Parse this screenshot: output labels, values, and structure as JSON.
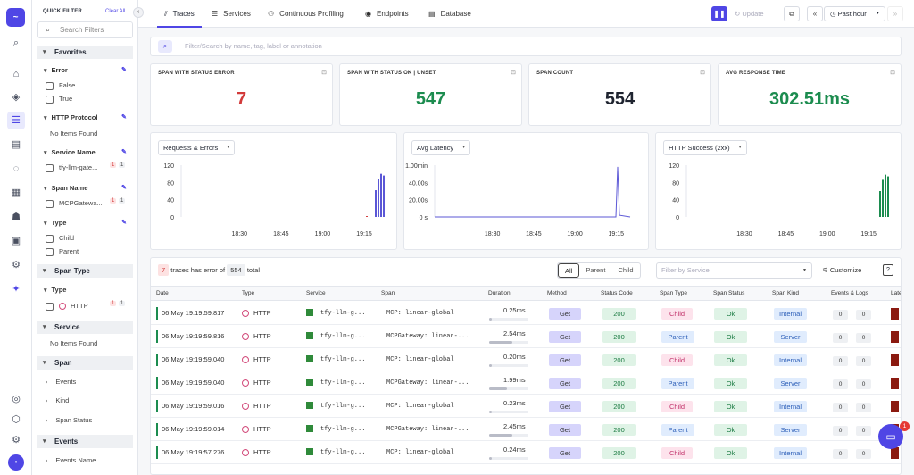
{
  "app": {
    "logo_text": "~"
  },
  "filter_panel": {
    "title": "QUICK FILTER",
    "clear_all": "Clear All",
    "search_placeholder": "Search Filters",
    "sections": {
      "favorites": "Favorites",
      "span_type": "Span Type",
      "service": "Service",
      "span": "Span",
      "events": "Events"
    },
    "error": {
      "label": "Error",
      "options": [
        "False",
        "True"
      ]
    },
    "http_protocol": {
      "label": "HTTP Protocol",
      "empty": "No Items Found"
    },
    "service_name": {
      "label": "Service Name",
      "value": "tfy-llm-gate...",
      "c1": "1",
      "c2": "1"
    },
    "span_name": {
      "label": "Span Name",
      "value": "MCPGatewa...",
      "c1": "1",
      "c2": "1"
    },
    "type": {
      "label": "Type",
      "options": [
        "Child",
        "Parent"
      ]
    },
    "span_type_type": {
      "label": "Type",
      "value": "HTTP",
      "c1": "1",
      "c2": "1"
    },
    "service_empty": "No Items Found",
    "span_items": [
      "Events",
      "Kind",
      "Span Status"
    ],
    "events_items": [
      "Events Name"
    ]
  },
  "tabs": [
    "Traces",
    "Services",
    "Continuous Profiling",
    "Endpoints",
    "Database"
  ],
  "toolbar": {
    "update": "Update",
    "time_range": "Past hour"
  },
  "search_placeholder": "Filter/Search by name, tag, label or annotation",
  "stats": [
    {
      "title": "SPAN WITH STATUS ERROR",
      "value": "7",
      "color": "#d23a3a"
    },
    {
      "title": "SPAN WITH STATUS OK | UNSET",
      "value": "547",
      "color": "#1c8c4f"
    },
    {
      "title": "SPAN COUNT",
      "value": "554",
      "color": "#1f2430"
    },
    {
      "title": "AVG RESPONSE TIME",
      "value": "302.51ms",
      "color": "#1c8c4f"
    }
  ],
  "charts": {
    "c1": {
      "select": "Requests & Errors",
      "y_ticks": [
        "120",
        "80",
        "40",
        "0"
      ],
      "x_ticks": [
        "18:30",
        "18:45",
        "19:00",
        "19:15"
      ]
    },
    "c2": {
      "select": "Avg Latency",
      "y_ticks": [
        "1.00min",
        "40.00s",
        "20.00s",
        "0 s"
      ],
      "x_ticks": [
        "18:30",
        "18:45",
        "19:00",
        "19:15"
      ]
    },
    "c3": {
      "select": "HTTP Success (2xx)",
      "y_ticks": [
        "120",
        "80",
        "40",
        "0"
      ],
      "x_ticks": [
        "18:30",
        "18:45",
        "19:00",
        "19:15"
      ]
    }
  },
  "chart_data": [
    {
      "type": "bar",
      "select": "Requests & Errors",
      "x": [
        "18:30",
        "18:45",
        "19:00",
        "19:15"
      ],
      "ylim": [
        0,
        120
      ],
      "series": [
        {
          "values": [
            0,
            0,
            0,
            62,
            88,
            100,
            96
          ]
        },
        {
          "values": [
            0,
            0,
            0,
            2,
            0,
            0,
            0
          ]
        }
      ],
      "colors": [
        "#5b57d6",
        "#d23a3a"
      ]
    },
    {
      "type": "line",
      "select": "Avg Latency",
      "x": [
        "18:30",
        "18:45",
        "19:00",
        "19:15"
      ],
      "ylim": [
        0,
        60
      ],
      "series": [
        {
          "values": [
            0,
            58,
            2,
            0
          ]
        }
      ],
      "colors": [
        "#5b57d6"
      ]
    },
    {
      "type": "bar",
      "select": "HTTP Success (2xx)",
      "x": [
        "18:30",
        "18:45",
        "19:00",
        "19:15"
      ],
      "ylim": [
        0,
        120
      ],
      "series": [
        {
          "values": [
            60,
            86,
            98,
            94
          ]
        }
      ],
      "colors": [
        "#1c8c4f"
      ]
    }
  ],
  "table": {
    "summary": {
      "errors": "7",
      "text": "traces has error of",
      "total": "554",
      "total_label": "total"
    },
    "filters": [
      "All",
      "Parent",
      "Child"
    ],
    "service_placeholder": "Filter by Service",
    "customize": "Customize",
    "headers": [
      "Date",
      "Type",
      "Service",
      "Span",
      "Duration",
      "Method",
      "Status Code",
      "Span Type",
      "Span Status",
      "Span Kind",
      "Events & Logs",
      "Late"
    ],
    "rows": [
      {
        "date": "06 May 19:19:59.817",
        "type": "HTTP",
        "service": "tfy-llm-g...",
        "span": "MCP: linear-global",
        "duration": "0.25ms",
        "dur_frac": 0.07,
        "method": "Get",
        "code": "200",
        "span_type": "Child",
        "status": "Ok",
        "kind": "Internal",
        "e": "0",
        "l": "0"
      },
      {
        "date": "06 May 19:19:59.816",
        "type": "HTTP",
        "service": "tfy-llm-g...",
        "span": "MCPGateway: linear-...",
        "duration": "2.54ms",
        "dur_frac": 0.6,
        "method": "Get",
        "code": "200",
        "span_type": "Parent",
        "status": "Ok",
        "kind": "Server",
        "e": "0",
        "l": "0"
      },
      {
        "date": "06 May 19:19:59.040",
        "type": "HTTP",
        "service": "tfy-llm-g...",
        "span": "MCP: linear-global",
        "duration": "0.20ms",
        "dur_frac": 0.06,
        "method": "Get",
        "code": "200",
        "span_type": "Child",
        "status": "Ok",
        "kind": "Internal",
        "e": "0",
        "l": "0"
      },
      {
        "date": "06 May 19:19:59.040",
        "type": "HTTP",
        "service": "tfy-llm-g...",
        "span": "MCPGateway: linear-...",
        "duration": "1.99ms",
        "dur_frac": 0.45,
        "method": "Get",
        "code": "200",
        "span_type": "Parent",
        "status": "Ok",
        "kind": "Server",
        "e": "0",
        "l": "0"
      },
      {
        "date": "06 May 19:19:59.016",
        "type": "HTTP",
        "service": "tfy-llm-g...",
        "span": "MCP: linear-global",
        "duration": "0.23ms",
        "dur_frac": 0.07,
        "method": "Get",
        "code": "200",
        "span_type": "Child",
        "status": "Ok",
        "kind": "Internal",
        "e": "0",
        "l": "0"
      },
      {
        "date": "06 May 19:19:59.014",
        "type": "HTTP",
        "service": "tfy-llm-g...",
        "span": "MCPGateway: linear-...",
        "duration": "2.45ms",
        "dur_frac": 0.58,
        "method": "Get",
        "code": "200",
        "span_type": "Parent",
        "status": "Ok",
        "kind": "Server",
        "e": "0",
        "l": "0"
      },
      {
        "date": "06 May 19:19:57.276",
        "type": "HTTP",
        "service": "tfy-llm-g...",
        "span": "MCP: linear-global",
        "duration": "0.24ms",
        "dur_frac": 0.07,
        "method": "Get",
        "code": "200",
        "span_type": "Child",
        "status": "Ok",
        "kind": "Internal",
        "e": "0",
        "l": "0"
      }
    ]
  },
  "chat": {
    "badge": "1"
  }
}
